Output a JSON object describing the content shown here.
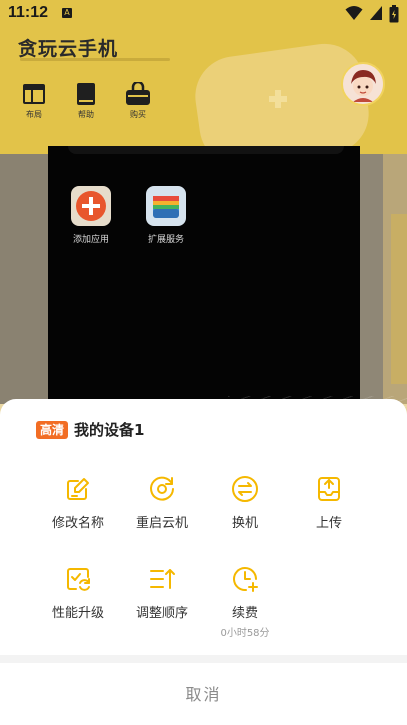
{
  "status_bar": {
    "time": "11:12",
    "notification_letter": "A"
  },
  "app": {
    "title": "贪玩云手机",
    "quick_actions": [
      {
        "label": "布局",
        "icon": "layout-icon"
      },
      {
        "label": "帮助",
        "icon": "book-icon"
      },
      {
        "label": "购买",
        "icon": "shopping-bag-icon"
      }
    ]
  },
  "cloud_phone": {
    "apps": [
      {
        "label": "添加应用",
        "icon": "add-app-icon"
      },
      {
        "label": "扩展服务",
        "icon": "wallet-icon"
      }
    ]
  },
  "sheet": {
    "badge": "高清",
    "device_name": "我的设备1",
    "actions": [
      {
        "label": "修改名称",
        "icon": "edit-icon"
      },
      {
        "label": "重启云机",
        "icon": "restart-icon"
      },
      {
        "label": "换机",
        "icon": "swap-icon"
      },
      {
        "label": "上传",
        "icon": "upload-icon"
      },
      {
        "label": "性能升级",
        "icon": "upgrade-icon"
      },
      {
        "label": "调整顺序",
        "icon": "reorder-icon"
      },
      {
        "label": "续费",
        "icon": "clock-icon",
        "sub": "0小时58分"
      }
    ],
    "cancel_label": "取消"
  },
  "colors": {
    "accent": "#F5B800",
    "badge": "#F26D24",
    "header": "#E2C349"
  }
}
